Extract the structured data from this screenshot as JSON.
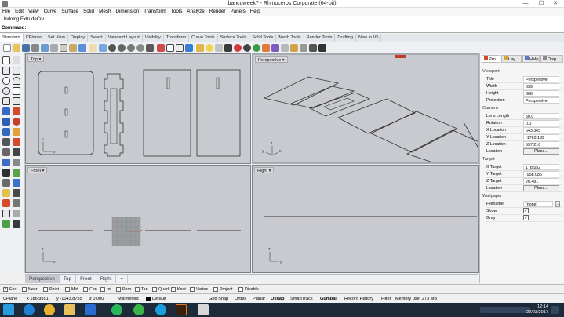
{
  "window": {
    "title": "bancoweek7 - Rhinoceros Corporate (64-bit)",
    "minimize": "—",
    "maximize": "☐",
    "close": "✕"
  },
  "menu": [
    "File",
    "Edit",
    "View",
    "Curve",
    "Surface",
    "Solid",
    "Mesh",
    "Dimension",
    "Transform",
    "Tools",
    "Analyze",
    "Render",
    "Panels",
    "Help"
  ],
  "history": "Undoing ExtrudeCrv",
  "command": {
    "label": "Command:",
    "value": ""
  },
  "toolbar_tabs": [
    "Standard",
    "CPlanes",
    "Set View",
    "Display",
    "Select",
    "Viewport Layout",
    "Visibility",
    "Transform",
    "Curve Tools",
    "Surface Tools",
    "Solid Tools",
    "Mesh Tools",
    "Render Tools",
    "Drafting",
    "New in V5"
  ],
  "viewports": {
    "top": {
      "label": "Top"
    },
    "perspective": {
      "label": "Perspective"
    },
    "front": {
      "label": "Front"
    },
    "right": {
      "label": "Right"
    },
    "axis": {
      "x": "x",
      "y": "y",
      "z": "z"
    }
  },
  "viewport_tabs": [
    "Perspective",
    "Top",
    "Front",
    "Right"
  ],
  "panel": {
    "tabs": [
      "Pro...",
      "Lay...",
      "Help",
      "Disp..."
    ],
    "sections": {
      "viewport": "Viewport",
      "camera": "Camera",
      "target": "Target",
      "wallpaper": "Wallpaper"
    },
    "viewport_rows": [
      {
        "label": "Title",
        "value": "Perspective"
      },
      {
        "label": "Width",
        "value": "639"
      },
      {
        "label": "Height",
        "value": "308"
      },
      {
        "label": "Projection",
        "value": "Perspective"
      }
    ],
    "camera_rows": [
      {
        "label": "Lens Length",
        "value": "50.0"
      },
      {
        "label": "Rotation",
        "value": "0.0"
      },
      {
        "label": "X Location",
        "value": "643.365"
      },
      {
        "label": "Y Location",
        "value": "-1763.189"
      },
      {
        "label": "Z Location",
        "value": "557.216"
      },
      {
        "label": "Location",
        "value": "Place..."
      }
    ],
    "target_rows": [
      {
        "label": "X Target",
        "value": "178.552"
      },
      {
        "label": "Y Target",
        "value": "-958.086"
      },
      {
        "label": "Z Target",
        "value": "20.481"
      },
      {
        "label": "Location",
        "value": "Place..."
      }
    ],
    "wallpaper_rows": [
      {
        "label": "Filename",
        "value": "(none)"
      },
      {
        "label": "Show",
        "value": "✓"
      },
      {
        "label": "Gray",
        "value": "✓"
      }
    ]
  },
  "osnaps": [
    {
      "label": "End",
      "checked": "✓"
    },
    {
      "label": "Near",
      "checked": ""
    },
    {
      "label": "Point",
      "checked": ""
    },
    {
      "label": "Mid",
      "checked": ""
    },
    {
      "label": "Cen",
      "checked": ""
    },
    {
      "label": "Int",
      "checked": ""
    },
    {
      "label": "Perp",
      "checked": ""
    },
    {
      "label": "Tan",
      "checked": ""
    },
    {
      "label": "Quad",
      "checked": ""
    },
    {
      "label": "Knot",
      "checked": ""
    },
    {
      "label": "Vertex",
      "checked": ""
    },
    {
      "label": "Project",
      "checked": ""
    },
    {
      "label": "Disable",
      "checked": ""
    }
  ],
  "status": {
    "cplane": "CPlane",
    "x": "x 186.9551",
    "y": "y -1043.8755",
    "z": "z 0.000",
    "units": "Millimeters",
    "layer": "Default",
    "grid_snap": "Grid Snap",
    "ortho": "Ortho",
    "planar": "Planar",
    "osnap": "Osnap",
    "smarttrack": "SmartTrack",
    "gumball": "Gumball",
    "record_history": "Record History",
    "filter": "Filter",
    "memory": "Memory use: 273 MB"
  },
  "taskbar": {
    "time": "12:14",
    "date": "22/03/2017"
  },
  "colors": {
    "viewport_bg": "#c8cacf",
    "taskbar_bg": "#1c2a3a",
    "x_axis": "#c0392b",
    "y_axis": "#27ae60"
  }
}
